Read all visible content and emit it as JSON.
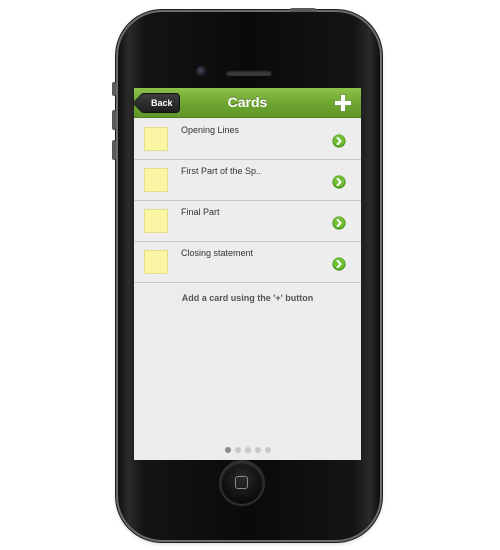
{
  "navbar": {
    "back_label": "Back",
    "title": "Cards",
    "add_icon": "plus-icon",
    "accent_color": "#6fa732"
  },
  "cards": [
    {
      "label": "Opening Lines",
      "thumb_color": "#fbf6a6",
      "icon": "chevron-right-icon"
    },
    {
      "label": "First Part of the Sp..",
      "thumb_color": "#fbf6a6",
      "icon": "chevron-right-icon"
    },
    {
      "label": "Final Part",
      "thumb_color": "#fbf6a6",
      "icon": "chevron-right-icon"
    },
    {
      "label": "Closing statement",
      "thumb_color": "#fbf6a6",
      "icon": "chevron-right-icon"
    }
  ],
  "hint": "Add a card using the '+' button",
  "pager": {
    "total": 5,
    "active": 1
  }
}
